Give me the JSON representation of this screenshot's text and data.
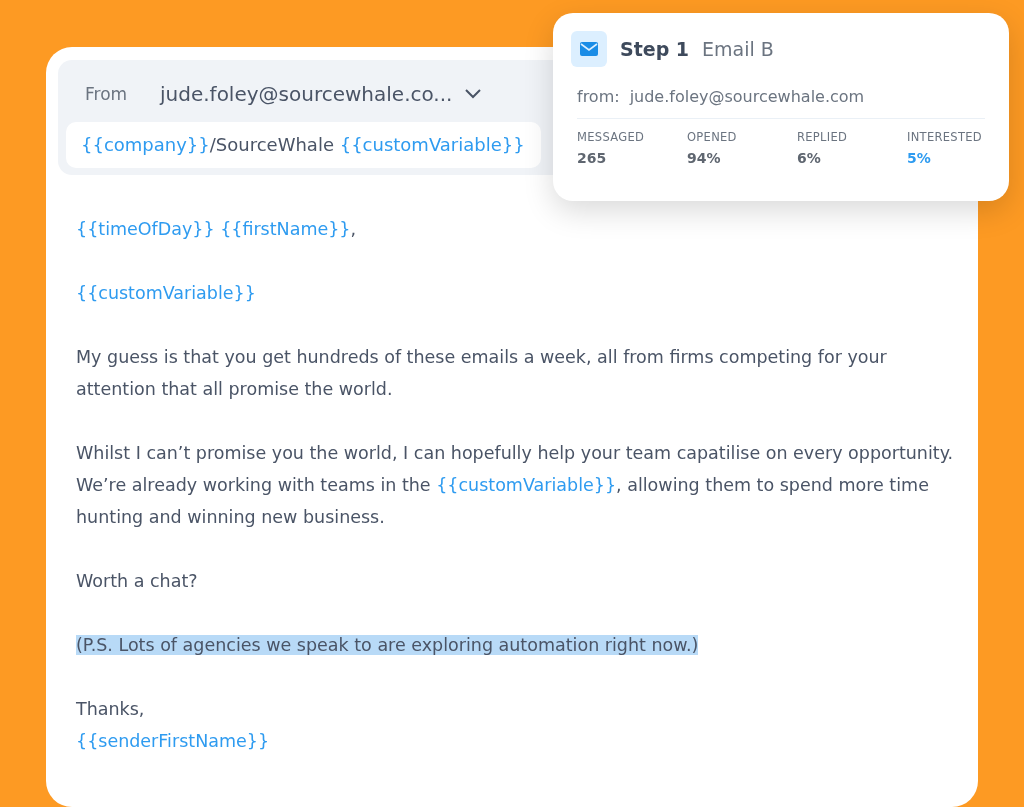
{
  "compose": {
    "from_label": "From",
    "from_value": "jude.foley@sourcewhale.co...",
    "subject": [
      {
        "kind": "variable",
        "text": "{{company}}"
      },
      {
        "kind": "plain",
        "text": "/SourceWhale "
      },
      {
        "kind": "variable",
        "text": "{{customVariable}}"
      }
    ],
    "body": [
      {
        "highlighted": false,
        "segments": [
          {
            "kind": "variable",
            "text": "{{timeOfDay}} {{firstName}}"
          },
          {
            "kind": "plain",
            "text": ","
          }
        ]
      },
      {
        "highlighted": false,
        "segments": [
          {
            "kind": "variable",
            "text": "{{customVariable}}"
          }
        ]
      },
      {
        "highlighted": false,
        "segments": [
          {
            "kind": "plain",
            "text": "My guess is that you get hundreds of these emails a week, all from firms competing for your attention that all promise the world."
          }
        ]
      },
      {
        "highlighted": false,
        "segments": [
          {
            "kind": "plain",
            "text": "Whilst I can’t promise you the world, I can hopefully help your team capatilise on every opportunity. We’re already working with teams in the "
          },
          {
            "kind": "variable",
            "text": "{{customVariable}}"
          },
          {
            "kind": "plain",
            "text": ", allowing them to spend more time hunting and winning new business."
          }
        ]
      },
      {
        "highlighted": false,
        "segments": [
          {
            "kind": "plain",
            "text": "Worth a chat?"
          }
        ]
      },
      {
        "highlighted": true,
        "segments": [
          {
            "kind": "plain",
            "text": "(P.S. Lots of agencies we speak to are exploring automation right now.)"
          }
        ]
      },
      {
        "highlighted": false,
        "segments": [
          {
            "kind": "plain",
            "text": "Thanks,"
          },
          {
            "kind": "break"
          },
          {
            "kind": "variable",
            "text": "{{senderFirstName}}"
          }
        ]
      }
    ]
  },
  "step_card": {
    "step": "Step 1",
    "variant": "Email B",
    "from_label": "from:",
    "from_value": "jude.foley@sourcewhale.com",
    "stats": [
      {
        "label": "MESSAGED",
        "value": "265",
        "color": "#5f6670"
      },
      {
        "label": "OPENED",
        "value": "94%",
        "color": "#5f6670"
      },
      {
        "label": "REPLIED",
        "value": "6%",
        "color": "#5f6670"
      },
      {
        "label": "INTERESTED",
        "value": "5%",
        "color": "#2e9bf0"
      }
    ]
  }
}
